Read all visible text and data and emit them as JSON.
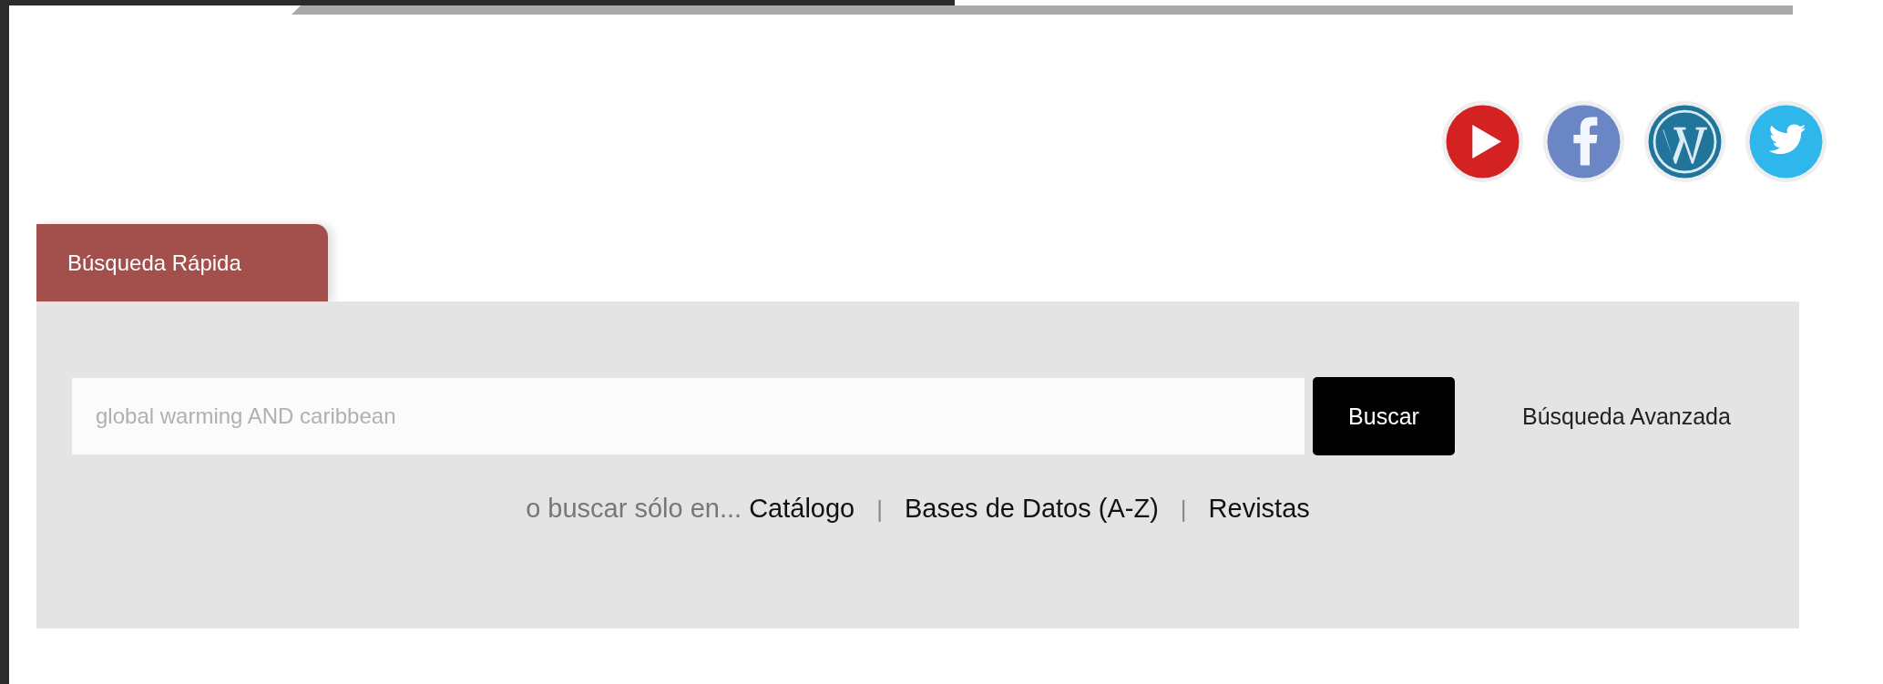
{
  "tabs": [
    {
      "label": "Búsqueda Rápida",
      "selected": true
    }
  ],
  "search": {
    "placeholder": "global warming AND caribbean",
    "button": "Buscar",
    "advanced_link": "Búsqueda Avanzada"
  },
  "scope": {
    "prefix": "o buscar sólo en...",
    "items": [
      {
        "kind": "link",
        "text": "Catálogo"
      },
      {
        "kind": "separator",
        "text": "|"
      },
      {
        "kind": "link",
        "text": "Bases de Datos (A-Z)"
      },
      {
        "kind": "separator",
        "text": "|"
      },
      {
        "kind": "link",
        "text": "Revistas"
      }
    ]
  }
}
